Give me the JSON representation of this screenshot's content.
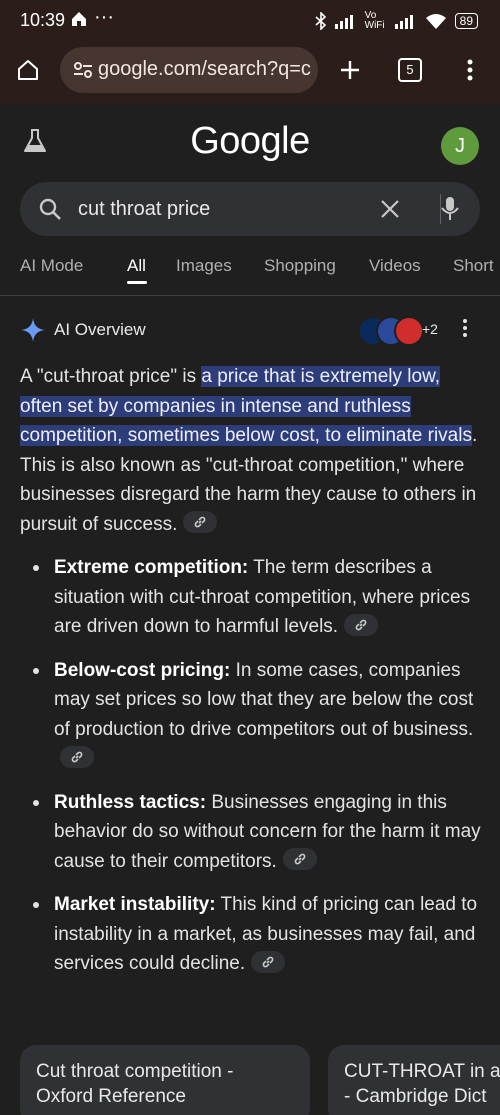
{
  "status": {
    "time": "10:39",
    "wifi_label": "Vo WiFi",
    "battery": "89"
  },
  "browser": {
    "url": "google.com/search?q=c",
    "tab_count": "5"
  },
  "google": {
    "logo": "Google",
    "avatar_letter": "J"
  },
  "search": {
    "query": "cut throat price"
  },
  "tabs": [
    "AI Mode",
    "All",
    "Images",
    "Shopping",
    "Videos",
    "Short"
  ],
  "active_tab": "All",
  "ai_overview": {
    "title": "AI Overview",
    "sources_more": "+2",
    "intro_pre": "A \"cut-throat price\" is ",
    "intro_highlight": "a price that is extremely low, often set by companies in intense and ruthless competition, sometimes below cost, to eliminate rivals",
    "intro_post": ". This is also known as \"cut-throat competition,\" where businesses disregard the harm they cause to others in pursuit of success.",
    "bullets": [
      {
        "term": "Extreme competition:",
        "text": " The term describes a situation with cut-throat competition, where prices are driven down to harmful levels."
      },
      {
        "term": "Below-cost pricing:",
        "text": " In some cases, companies may set prices so low that they are below the cost of production to drive competitors out of business."
      },
      {
        "term": "Ruthless tactics:",
        "text": " Businesses engaging in this behavior do so without concern for the harm it may cause to their competitors."
      },
      {
        "term": "Market instability:",
        "text": " This kind of pricing can lead to instability in a market, as businesses may fail, and services could decline."
      }
    ]
  },
  "cards": [
    {
      "line1": "Cut throat competition -",
      "line2": "Oxford Reference"
    },
    {
      "line1": "CUT-THROAT in a",
      "line2": "- Cambridge Dict"
    }
  ],
  "colors": {
    "accent_highlight": "#2d3d7a",
    "avatar": "#5f9b3c",
    "browser_bar": "#2b1d19"
  }
}
